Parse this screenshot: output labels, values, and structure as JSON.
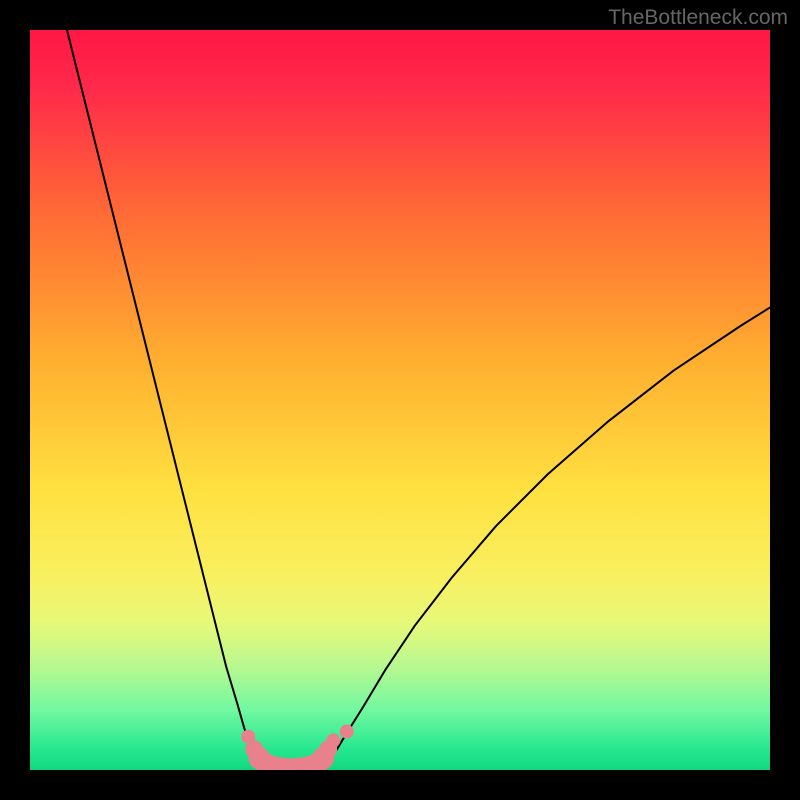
{
  "watermark": "TheBottleneck.com",
  "chart_data": {
    "type": "line",
    "title": "",
    "xlabel": "",
    "ylabel": "",
    "xlim": [
      0,
      100
    ],
    "ylim": [
      0,
      100
    ],
    "background": {
      "type": "vertical-gradient",
      "stops": [
        {
          "offset": 0,
          "color": "#ff1744"
        },
        {
          "offset": 8,
          "color": "#ff2a4a"
        },
        {
          "offset": 25,
          "color": "#ff6b35"
        },
        {
          "offset": 45,
          "color": "#ffb030"
        },
        {
          "offset": 62,
          "color": "#ffe040"
        },
        {
          "offset": 74,
          "color": "#f8f060"
        },
        {
          "offset": 80,
          "color": "#e8f878"
        },
        {
          "offset": 86,
          "color": "#b8f890"
        },
        {
          "offset": 92,
          "color": "#70f8a0"
        },
        {
          "offset": 97,
          "color": "#28e890"
        },
        {
          "offset": 100,
          "color": "#10d880"
        }
      ]
    },
    "series": [
      {
        "name": "left-curve",
        "color": "#000000",
        "width": 2,
        "x": [
          5,
          7,
          9,
          11,
          13,
          15,
          17,
          19,
          21,
          23,
          25,
          26.5,
          28,
          29,
          30,
          30.8,
          31.5,
          32,
          32.5
        ],
        "y": [
          100,
          92,
          84,
          76,
          68,
          60,
          52,
          44,
          36,
          28,
          20,
          14,
          9,
          5.5,
          3,
          1.5,
          0.7,
          0.3,
          0.1
        ]
      },
      {
        "name": "right-curve",
        "color": "#000000",
        "width": 2,
        "x": [
          39,
          39.5,
          40,
          41,
          42.5,
          45,
          48,
          52,
          57,
          63,
          70,
          78,
          87,
          96,
          100
        ],
        "y": [
          0.1,
          0.3,
          0.8,
          2,
          4.5,
          8.5,
          13.5,
          19.5,
          26,
          33,
          40,
          47,
          54,
          60,
          62.5
        ]
      },
      {
        "name": "valley-floor",
        "color": "#000000",
        "width": 2,
        "x": [
          32.5,
          34,
          35.5,
          37,
          38.5,
          39
        ],
        "y": [
          0.1,
          0,
          0,
          0,
          0,
          0.1
        ]
      }
    ],
    "markers": [
      {
        "name": "highlight-dots",
        "color": "#e8818c",
        "radius_sequence": [
          7,
          9,
          11,
          11,
          12,
          12,
          12,
          12,
          12,
          11,
          11,
          9,
          7,
          7
        ],
        "points": [
          {
            "x": 29.5,
            "y": 4.5
          },
          {
            "x": 30.3,
            "y": 2.8
          },
          {
            "x": 31.0,
            "y": 1.6
          },
          {
            "x": 31.8,
            "y": 0.8
          },
          {
            "x": 32.8,
            "y": 0.3
          },
          {
            "x": 34.0,
            "y": 0.1
          },
          {
            "x": 35.3,
            "y": 0.0
          },
          {
            "x": 36.6,
            "y": 0.1
          },
          {
            "x": 37.8,
            "y": 0.3
          },
          {
            "x": 38.8,
            "y": 0.8
          },
          {
            "x": 39.6,
            "y": 1.6
          },
          {
            "x": 40.3,
            "y": 2.8
          },
          {
            "x": 41.0,
            "y": 4.0
          },
          {
            "x": 42.8,
            "y": 5.2
          }
        ]
      }
    ]
  }
}
